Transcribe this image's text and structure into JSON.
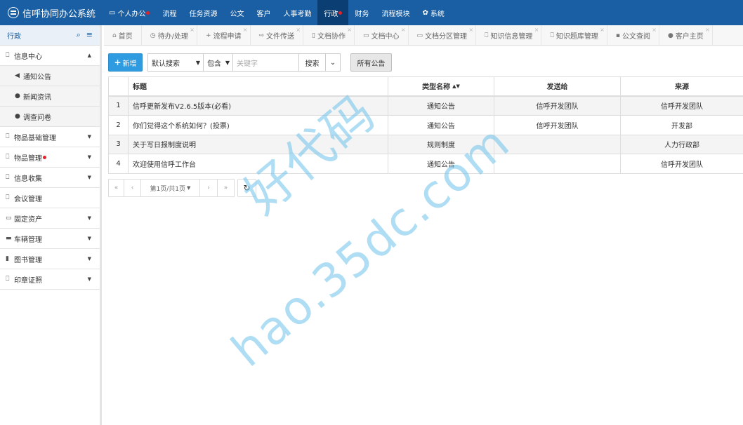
{
  "app": {
    "title": "信呼协同办公系统"
  },
  "topnav": [
    {
      "label": "个人办公",
      "icon": "monitor-icon",
      "dot": true
    },
    {
      "label": "流程",
      "dot": false
    },
    {
      "label": "任务资源",
      "dot": false
    },
    {
      "label": "公文",
      "dot": false
    },
    {
      "label": "客户",
      "dot": false
    },
    {
      "label": "人事考勤",
      "dot": false
    },
    {
      "label": "行政",
      "dot": true,
      "active": true
    },
    {
      "label": "财务",
      "dot": false
    },
    {
      "label": "流程模块",
      "dot": false
    },
    {
      "label": "系统",
      "icon": "gear-icon",
      "dot": false
    }
  ],
  "sidebar": {
    "title": "行政",
    "items": [
      {
        "label": "信息中心",
        "icon": "bookmark-icon",
        "expanded": true
      },
      {
        "label": "通知公告",
        "icon": "volume-icon",
        "sub": true
      },
      {
        "label": "新闻资讯",
        "icon": "globe-icon",
        "sub": true
      },
      {
        "label": "调查问卷",
        "icon": "question-icon",
        "sub": true
      },
      {
        "label": "物品基础管理",
        "icon": "bookmark-icon",
        "caret": true
      },
      {
        "label": "物品管理",
        "icon": "bookmark-icon",
        "caret": true,
        "dot": true
      },
      {
        "label": "信息收集",
        "icon": "bookmark-icon",
        "caret": true
      },
      {
        "label": "会议管理",
        "icon": "bookmark-icon"
      },
      {
        "label": "固定资产",
        "icon": "laptop-icon",
        "caret": true
      },
      {
        "label": "车辆管理",
        "icon": "truck-icon",
        "caret": true
      },
      {
        "label": "图书管理",
        "icon": "book-icon",
        "caret": true
      },
      {
        "label": "印章证照",
        "icon": "bookmark-icon",
        "caret": true
      }
    ]
  },
  "tabs": [
    {
      "label": "首页",
      "icon": "home-icon"
    },
    {
      "label": "待办/处理",
      "icon": "clock-icon"
    },
    {
      "label": "流程申请",
      "icon": "plus-icon"
    },
    {
      "label": "文件传送",
      "icon": "share-icon"
    },
    {
      "label": "文档协作",
      "icon": "file-icon"
    },
    {
      "label": "文档中心",
      "icon": "folder-icon"
    },
    {
      "label": "文档分区管理",
      "icon": "folder-icon"
    },
    {
      "label": "知识信息管理",
      "icon": "bookmark-icon"
    },
    {
      "label": "知识题库管理",
      "icon": "bookmark-icon"
    },
    {
      "label": "公文查阅",
      "icon": "briefcase-icon"
    },
    {
      "label": "客户主页",
      "icon": "user-icon"
    }
  ],
  "toolbar": {
    "add_label": "新增",
    "search_scope": "默认搜索",
    "match_mode": "包含",
    "keyword_placeholder": "关键字",
    "search_label": "搜索",
    "all_label": "所有公告"
  },
  "table": {
    "columns": [
      "",
      "标题",
      "类型名称",
      "发送给",
      "来源"
    ],
    "rows": [
      [
        "1",
        "信呼更新发布V2.6.5版本(必看)",
        "通知公告",
        "信呼开发团队",
        "信呼开发团队"
      ],
      [
        "2",
        "你们觉得这个系统如何？(投票)",
        "通知公告",
        "信呼开发团队",
        "开发部"
      ],
      [
        "3",
        "关于写日报制度说明",
        "规则制度",
        "",
        "人力行政部"
      ],
      [
        "4",
        "欢迎使用信呼工作台",
        "通知公告",
        "",
        "信呼开发团队"
      ]
    ]
  },
  "pager": {
    "first": "«",
    "prev": "‹",
    "page_label": "第1页/共1页",
    "next": "›",
    "last": "»"
  },
  "watermark": {
    "line1": "好代码",
    "line2": "hao.35dc.com"
  }
}
